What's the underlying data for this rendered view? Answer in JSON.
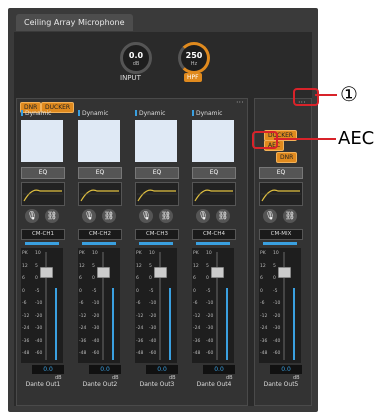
{
  "window": {
    "title": "Ceiling Array Microphone"
  },
  "input": {
    "knob1": {
      "value": "0.0",
      "unit": "dB"
    },
    "knob2": {
      "value": "250",
      "unit": "Hz"
    },
    "label": "INPUT",
    "hpf": "HPF"
  },
  "left_group": {
    "dnr": "DNR",
    "ducker": "DUCKER",
    "dots": "···"
  },
  "right_group": {
    "dots": "···",
    "ducker": "DUCKER",
    "aec": "AEC",
    "dnr": "DNR"
  },
  "channels": [
    {
      "type": "Dynamic",
      "eq": "EQ",
      "name": "CM-CH1",
      "value": "0.0",
      "unit": "dB",
      "output": "Dante Out1"
    },
    {
      "type": "Dynamic",
      "eq": "EQ",
      "name": "CM-CH2",
      "value": "0.0",
      "unit": "dB",
      "output": "Dante Out2"
    },
    {
      "type": "Dynamic",
      "eq": "EQ",
      "name": "CM-CH3",
      "value": "0.0",
      "unit": "dB",
      "output": "Dante Out3"
    },
    {
      "type": "Dynamic",
      "eq": "EQ",
      "name": "CM-CH4",
      "value": "0.0",
      "unit": "dB",
      "output": "Dante Out4"
    }
  ],
  "mix": {
    "eq": "EQ",
    "name": "CM-MIX",
    "value": "0.0",
    "unit": "dB",
    "output": "Dante Out5"
  },
  "scale": [
    "PK",
    "12",
    "6",
    "0",
    "-6",
    "-12",
    "-24",
    "-36",
    "-48"
  ],
  "fader_scale": [
    "10",
    "5",
    "0",
    "-5",
    "-10",
    "-20",
    "-30",
    "-40",
    "-60"
  ],
  "annotations": {
    "one": "①",
    "aec": "AEC"
  },
  "colors": {
    "accent": "#e08a1e",
    "meter": "#3aa0e0",
    "annotation": "#d8232a"
  }
}
